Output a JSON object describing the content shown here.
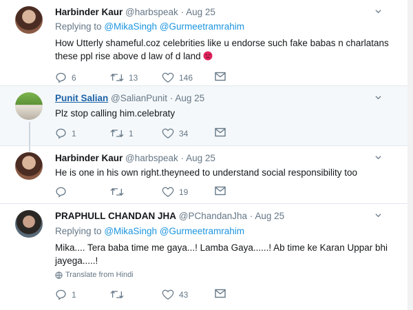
{
  "tweets": [
    {
      "name": "Harbinder Kaur",
      "handle": "@harbspeak",
      "date": "· Aug 25",
      "replying_prefix": "Replying to",
      "replying_mentions": [
        "@MikaSingh",
        "@Gurmeetramrahim"
      ],
      "text_lines": [
        "How Utterly shameful.coz celebrities like u endorse such fake babas n charlatans",
        "these ppl rise above d law of d land"
      ],
      "emoji": "angry-face",
      "counts": {
        "reply": "6",
        "retweet": "13",
        "like": "146"
      }
    },
    {
      "name": "Punit Salian",
      "handle": "@SalianPunit",
      "date": "· Aug 25",
      "text_lines": [
        "Plz stop calling him.celebraty"
      ],
      "counts": {
        "reply": "1",
        "retweet": "1",
        "like": "34"
      }
    },
    {
      "name": "Harbinder Kaur",
      "handle": "@harbspeak",
      "date": "· Aug 25",
      "text_lines": [
        "He is one in his own right.theyneed to understand social responsibility too"
      ],
      "counts": {
        "reply": "",
        "retweet": "",
        "like": "19"
      }
    },
    {
      "name": "PRAPHULL CHANDAN JHA",
      "handle": "@PChandanJha",
      "date": "· Aug 25",
      "replying_prefix": "Replying to",
      "replying_mentions": [
        "@MikaSingh",
        "@Gurmeetramrahim"
      ],
      "text_lines": [
        "Mika.... Tera baba time me gaya...! Lamba Gaya......! Ab time ke Karan Uppar bhi",
        "jayega.....!"
      ],
      "translate_label": "Translate from Hindi",
      "counts": {
        "reply": "1",
        "retweet": "",
        "like": "43"
      }
    }
  ],
  "colors": {
    "link": "#1b95e0",
    "meta": "#657786",
    "highlight_bg": "#f5f8fa",
    "divider": "#e1e8ed"
  }
}
